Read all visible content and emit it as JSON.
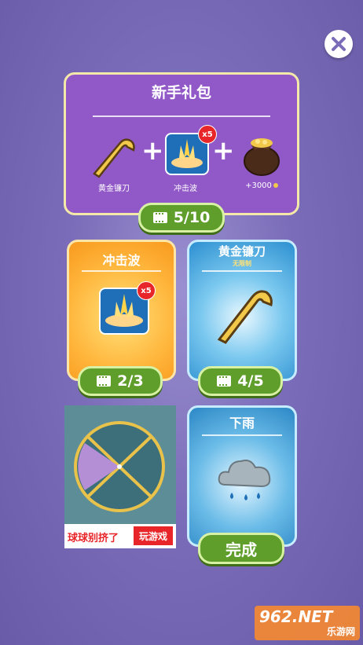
{
  "close": {
    "icon": "close-icon"
  },
  "newbie_pack": {
    "title": "新手礼包",
    "items": [
      {
        "label": "黄金镰刀",
        "icon": "golden-sickle-icon"
      },
      {
        "label": "冲击波",
        "icon": "shockwave-icon",
        "badge": "x5"
      },
      {
        "label": "+3000",
        "icon": "coin-bag-icon"
      }
    ],
    "progress": "5/10"
  },
  "shockwave_card": {
    "title": "冲击波",
    "badge": "x5",
    "progress": "2/3"
  },
  "sickle_card": {
    "title": "黄金镰刀",
    "subtitle": "无限制",
    "progress": "4/5"
  },
  "ad_banner": {
    "text": "球球别挤了",
    "cta": "玩游戏"
  },
  "rain_card": {
    "title": "下雨",
    "button": "完成"
  },
  "watermark": {
    "brand": "962.NET",
    "sub": "乐游网"
  },
  "colors": {
    "purple_card": "#9159c7",
    "orange_card": "#ffb43a",
    "blue_card": "#2c8fd0",
    "green_button": "#5f9e2b"
  }
}
